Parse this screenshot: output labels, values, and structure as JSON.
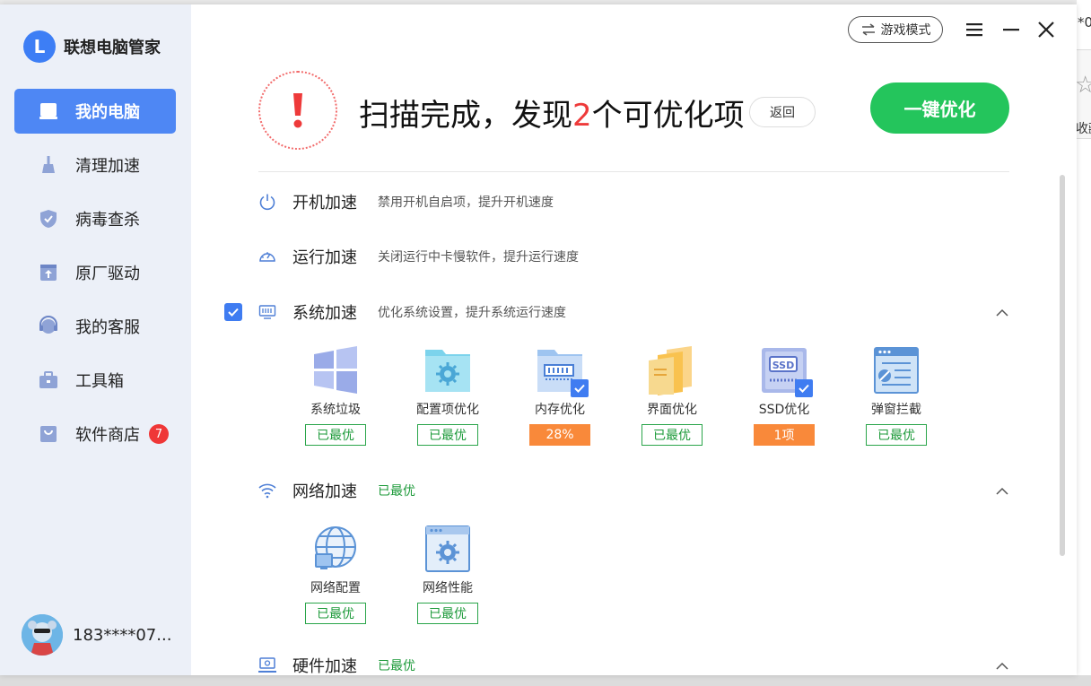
{
  "background": {
    "peek_text": "*0",
    "peek_text2": "收藏"
  },
  "app": {
    "name": "联想电脑管家",
    "logo_letter": "L"
  },
  "sidebar": {
    "items": [
      {
        "label": "我的电脑",
        "icon": "laptop-icon",
        "active": true
      },
      {
        "label": "清理加速",
        "icon": "broom-icon"
      },
      {
        "label": "病毒查杀",
        "icon": "shield-icon"
      },
      {
        "label": "原厂驱动",
        "icon": "driver-upload-icon"
      },
      {
        "label": "我的客服",
        "icon": "headset-icon"
      },
      {
        "label": "工具箱",
        "icon": "toolbox-icon"
      },
      {
        "label": "软件商店",
        "icon": "store-bag-icon",
        "badge": "7"
      }
    ],
    "user": {
      "name": "183****07..."
    }
  },
  "titlebar": {
    "game_mode": "游戏模式"
  },
  "scan": {
    "headline_prefix": "扫描完成，发现",
    "count": "2",
    "headline_suffix": "个可优化项",
    "back_label": "返回",
    "optimize_label": "一键优化"
  },
  "sections": [
    {
      "title": "开机加速",
      "desc": "禁用开机自启项，提升开机速度",
      "icon": "power-icon"
    },
    {
      "title": "运行加速",
      "desc": "关闭运行中卡慢软件，提升运行速度",
      "icon": "speedometer-icon"
    },
    {
      "title": "系统加速",
      "desc": "优化系统设置，提升系统运行速度",
      "icon": "system-settings-icon",
      "checked": true,
      "items": [
        {
          "label": "系统垃圾",
          "state": "已最优",
          "icon": "windows-icon"
        },
        {
          "label": "配置项优化",
          "state": "已最优",
          "icon": "config-folder-icon"
        },
        {
          "label": "内存优化",
          "state": "28%",
          "icon": "memory-icon",
          "warn": true,
          "checked": true
        },
        {
          "label": "界面优化",
          "state": "已最优",
          "icon": "interface-layers-icon"
        },
        {
          "label": "SSD优化",
          "state": "1项",
          "icon": "ssd-icon",
          "warn": true,
          "checked": true
        },
        {
          "label": "弹窗拦截",
          "state": "已最优",
          "icon": "popup-block-icon"
        }
      ]
    },
    {
      "title": "网络加速",
      "status": "已最优",
      "icon": "wifi-icon",
      "items": [
        {
          "label": "网络配置",
          "state": "已最优",
          "icon": "globe-network-icon"
        },
        {
          "label": "网络性能",
          "state": "已最优",
          "icon": "network-gear-icon"
        }
      ]
    },
    {
      "title": "硬件加速",
      "status": "已最优",
      "icon": "hardware-icon"
    }
  ],
  "colors": {
    "accent": "#4e87f4",
    "success": "#24c55c",
    "warn": "#f9893a",
    "alert": "#ee3a3a"
  },
  "ssd_text": "SSD"
}
